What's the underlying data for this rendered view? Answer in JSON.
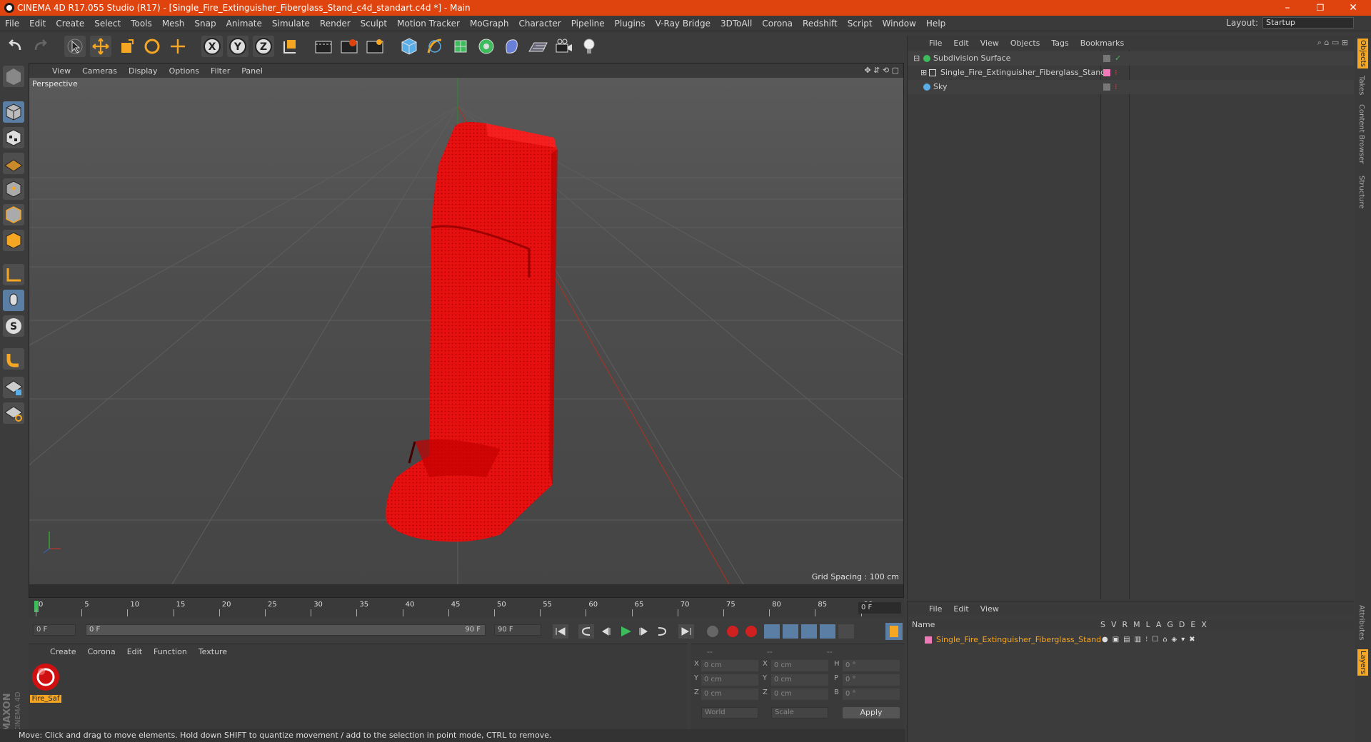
{
  "window": {
    "title": "CINEMA 4D R17.055 Studio (R17) - [Single_Fire_Extinguisher_Fiberglass_Stand_c4d_standart.c4d *] - Main",
    "min": "–",
    "restore": "❐",
    "close": "✕"
  },
  "menu": [
    "File",
    "Edit",
    "Create",
    "Select",
    "Tools",
    "Mesh",
    "Snap",
    "Animate",
    "Simulate",
    "Render",
    "Sculpt",
    "Motion Tracker",
    "MoGraph",
    "Character",
    "Pipeline",
    "Plugins",
    "V-Ray Bridge",
    "3DToAll",
    "Corona",
    "Redshift",
    "Script",
    "Window",
    "Help"
  ],
  "layout": {
    "label": "Layout:",
    "value": "Startup"
  },
  "viewport": {
    "menu": [
      "View",
      "Cameras",
      "Display",
      "Options",
      "Filter",
      "Panel"
    ],
    "name": "Perspective",
    "grid_spacing": "Grid Spacing : 100 cm"
  },
  "timeline": {
    "ticks": [
      "0",
      "5",
      "10",
      "15",
      "20",
      "25",
      "30",
      "35",
      "40",
      "45",
      "50",
      "55",
      "60",
      "65",
      "70",
      "75",
      "80",
      "85",
      "90"
    ],
    "current": "0 F"
  },
  "transport": {
    "start": "0 F",
    "range_start": "0 F",
    "range_end": "90 F",
    "end": "90 F"
  },
  "materials": {
    "menu": [
      "Create",
      "Corona",
      "Edit",
      "Function",
      "Texture"
    ],
    "items": [
      {
        "name": "Fire_Saf"
      }
    ]
  },
  "coords": {
    "header": [
      "--",
      "--",
      "--"
    ],
    "rows": [
      {
        "a": "X",
        "av": "0 cm",
        "b": "X",
        "bv": "0 cm",
        "c": "H",
        "cv": "0 °"
      },
      {
        "a": "Y",
        "av": "0 cm",
        "b": "Y",
        "bv": "0 cm",
        "c": "P",
        "cv": "0 °"
      },
      {
        "a": "Z",
        "av": "0 cm",
        "b": "Z",
        "bv": "0 cm",
        "c": "B",
        "cv": "0 °"
      }
    ],
    "world": "World",
    "scale": "Scale",
    "apply": "Apply"
  },
  "status": "Move: Click and drag to move elements. Hold down SHIFT to quantize movement / add to the selection in point mode, CTRL to remove.",
  "objects": {
    "menu": [
      "File",
      "Edit",
      "View",
      "Objects",
      "Tags",
      "Bookmarks"
    ],
    "items": [
      {
        "name": "Subdivision Surface"
      },
      {
        "name": "Single_Fire_Extinguisher_Fiberglass_Stand"
      },
      {
        "name": "Sky"
      }
    ]
  },
  "layers": {
    "menu": [
      "File",
      "Edit",
      "View"
    ],
    "header": {
      "name": "Name",
      "cols": [
        "S",
        "V",
        "R",
        "M",
        "L",
        "A",
        "G",
        "D",
        "E",
        "X"
      ]
    },
    "items": [
      {
        "name": "Single_Fire_Extinguisher_Fiberglass_Stand"
      }
    ]
  },
  "side_tabs": [
    "Objects",
    "Takes",
    "Content Browser",
    "Structure"
  ],
  "side_tabs_bottom": [
    "Attributes",
    "Layers"
  ],
  "brand": {
    "maxon": "MAXON",
    "c4d": "CINEMA 4D"
  }
}
